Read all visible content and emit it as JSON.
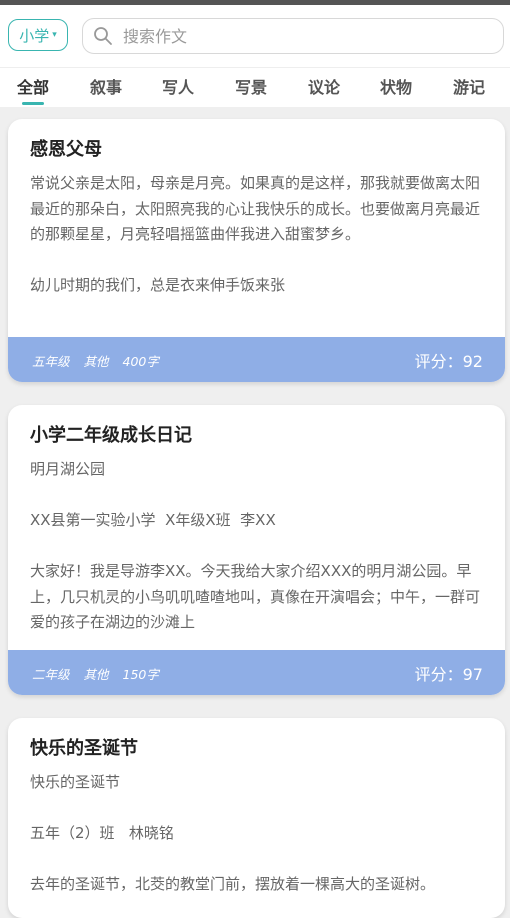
{
  "header": {
    "grade_label": "小学",
    "search_placeholder": "搜索作文"
  },
  "tabs": [
    {
      "label": "全部",
      "active": true
    },
    {
      "label": "叙事",
      "active": false
    },
    {
      "label": "写人",
      "active": false
    },
    {
      "label": "写景",
      "active": false
    },
    {
      "label": "议论",
      "active": false
    },
    {
      "label": "状物",
      "active": false
    },
    {
      "label": "游记",
      "active": false
    }
  ],
  "articles": [
    {
      "title": "感恩父母",
      "body": "常说父亲是太阳，母亲是月亮。如果真的是这样，那我就要做离太阳最近的那朵白，太阳照亮我的心让我快乐的成长。也要做离月亮最近的那颗星星，月亮轻唱摇篮曲伴我进入甜蜜梦乡。\n\n幼儿时期的我们，总是衣来伸手饭来张",
      "grade": "五年级",
      "category": "其他",
      "words": "400字",
      "score": "评分：92"
    },
    {
      "title": "小学二年级成长日记",
      "body": "明月湖公园\n\nXX县第一实验小学  X年级X班  李XX\n\n大家好！我是导游李XX。今天我给大家介绍XXX的明月湖公园。早上，几只机灵的小鸟叽叽喳喳地叫，真像在开演唱会；中午，一群可爱的孩子在湖边的沙滩上",
      "grade": "二年级",
      "category": "其他",
      "words": "150字",
      "score": "评分：97"
    },
    {
      "title": "快乐的圣诞节",
      "body": "快乐的圣诞节\n\n五年（2）班   林晓铭\n\n去年的圣诞节，北茭的教堂门前，摆放着一棵高大的圣诞树。",
      "grade": "",
      "category": "",
      "words": "",
      "score": ""
    }
  ]
}
